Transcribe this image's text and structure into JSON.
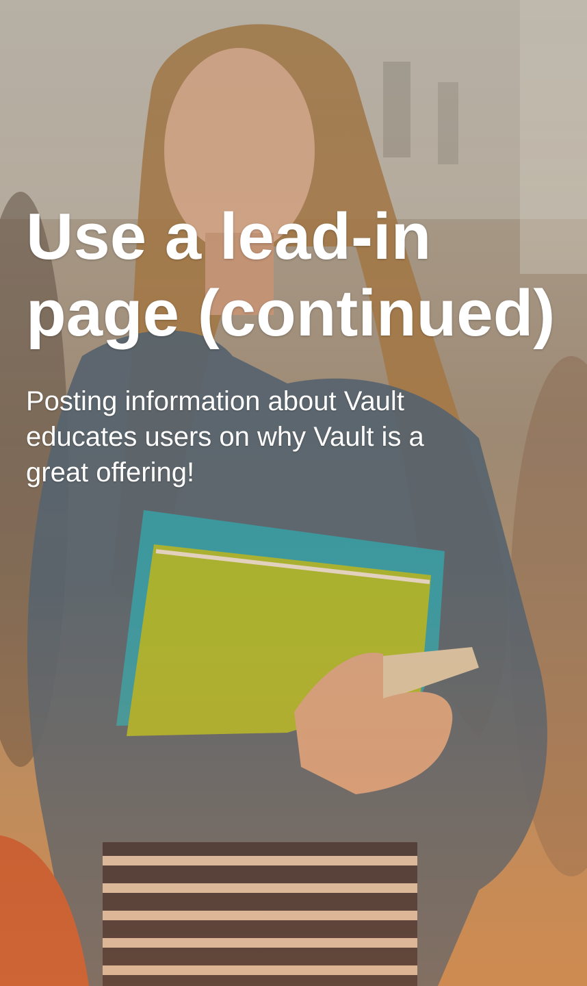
{
  "slide": {
    "title_line1": "Use a lead-in",
    "title_line2": "page (continued)",
    "subtitle": "Posting information about Vault educates users on why Vault is a great offering!"
  },
  "colors": {
    "text": "#ffffff",
    "warm_tint": "#c48a55",
    "notebook_green": "#a8b52a",
    "folder_teal": "#2f9aa6",
    "denim": "#4a5f72"
  }
}
